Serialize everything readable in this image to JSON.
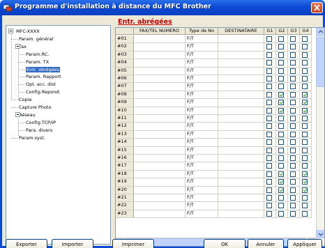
{
  "window": {
    "title": "Programme d'installation à distance du MFC Brother"
  },
  "tree": {
    "items": [
      {
        "label": "MFC-XXXX",
        "level": 0
      },
      {
        "label": "Param. général",
        "level": 1
      },
      {
        "label": "Fax",
        "level": 1
      },
      {
        "label": "Param.RC.",
        "level": 2
      },
      {
        "label": "Param. TX",
        "level": 2
      },
      {
        "label": "Entr. abrégées",
        "level": 2,
        "selected": true
      },
      {
        "label": "Param. Rapport",
        "level": 2
      },
      {
        "label": "Opt. acc. dist",
        "level": 2
      },
      {
        "label": "Config.Repond.",
        "level": 2
      },
      {
        "label": "Copie",
        "level": 1
      },
      {
        "label": "Capture Photo",
        "level": 1
      },
      {
        "label": "Réseau",
        "level": 1
      },
      {
        "label": "Config.TCP/IP",
        "level": 2
      },
      {
        "label": "Para. divers",
        "level": 2
      },
      {
        "label": "Param.syst.",
        "level": 1
      }
    ]
  },
  "main": {
    "section_title": "Entr. abrégées",
    "columns": [
      "",
      "FAX/TEL NUMERO",
      "Type de No",
      "DESTINATAIRE",
      "G1",
      "G2",
      "G3",
      "G4"
    ],
    "rows": [
      {
        "id": "#01",
        "type": "F/T",
        "groups": [
          false,
          false,
          false,
          false
        ]
      },
      {
        "id": "#02",
        "type": "F/T",
        "groups": [
          false,
          false,
          false,
          false
        ]
      },
      {
        "id": "#03",
        "type": "F/T",
        "groups": [
          false,
          false,
          false,
          false
        ]
      },
      {
        "id": "#04",
        "type": "F/T",
        "groups": [
          false,
          false,
          false,
          false
        ]
      },
      {
        "id": "#05",
        "type": "F/T",
        "groups": [
          false,
          false,
          false,
          false
        ]
      },
      {
        "id": "#06",
        "type": "F/T",
        "groups": [
          false,
          false,
          false,
          false
        ]
      },
      {
        "id": "#07",
        "type": "F/T",
        "groups": [
          false,
          false,
          false,
          false
        ]
      },
      {
        "id": "#08",
        "type": "F/T",
        "groups": [
          false,
          true,
          false,
          true
        ]
      },
      {
        "id": "#09",
        "type": "F/T",
        "groups": [
          false,
          true,
          false,
          true
        ]
      },
      {
        "id": "#10",
        "type": "F/T",
        "groups": [
          false,
          true,
          false,
          true
        ]
      },
      {
        "id": "#11",
        "type": "F/T",
        "groups": [
          false,
          false,
          false,
          false
        ]
      },
      {
        "id": "#12",
        "type": "F/T",
        "groups": [
          false,
          false,
          false,
          false
        ]
      },
      {
        "id": "#13",
        "type": "F/T",
        "groups": [
          false,
          false,
          false,
          false
        ]
      },
      {
        "id": "#14",
        "type": "F/T",
        "groups": [
          false,
          false,
          false,
          false
        ]
      },
      {
        "id": "#15",
        "type": "F/T",
        "groups": [
          false,
          false,
          false,
          false
        ]
      },
      {
        "id": "#16",
        "type": "F/T",
        "groups": [
          false,
          false,
          false,
          false
        ]
      },
      {
        "id": "#17",
        "type": "F/T",
        "groups": [
          false,
          false,
          false,
          false
        ]
      },
      {
        "id": "#18",
        "type": "F/T",
        "groups": [
          false,
          true,
          false,
          true
        ]
      },
      {
        "id": "#19",
        "type": "F/T",
        "groups": [
          false,
          true,
          false,
          true
        ]
      },
      {
        "id": "#20",
        "type": "F/T",
        "groups": [
          false,
          true,
          false,
          true
        ]
      },
      {
        "id": "#21",
        "type": "F/T",
        "groups": [
          false,
          false,
          false,
          false
        ]
      },
      {
        "id": "#22",
        "type": "F/T",
        "groups": [
          false,
          false,
          false,
          false
        ]
      },
      {
        "id": "#23",
        "type": "F/T",
        "groups": [
          false,
          false,
          false,
          false
        ]
      }
    ]
  },
  "buttons": {
    "export": "Exporter",
    "import": "Importer",
    "print": "Imprimer",
    "ok": "OK",
    "cancel": "Annuler",
    "apply": "Appliquer"
  },
  "colors": {
    "accent": "#0c4ad6",
    "section_title": "#c00000",
    "selection": "#316ac5",
    "check": "#21a121"
  }
}
